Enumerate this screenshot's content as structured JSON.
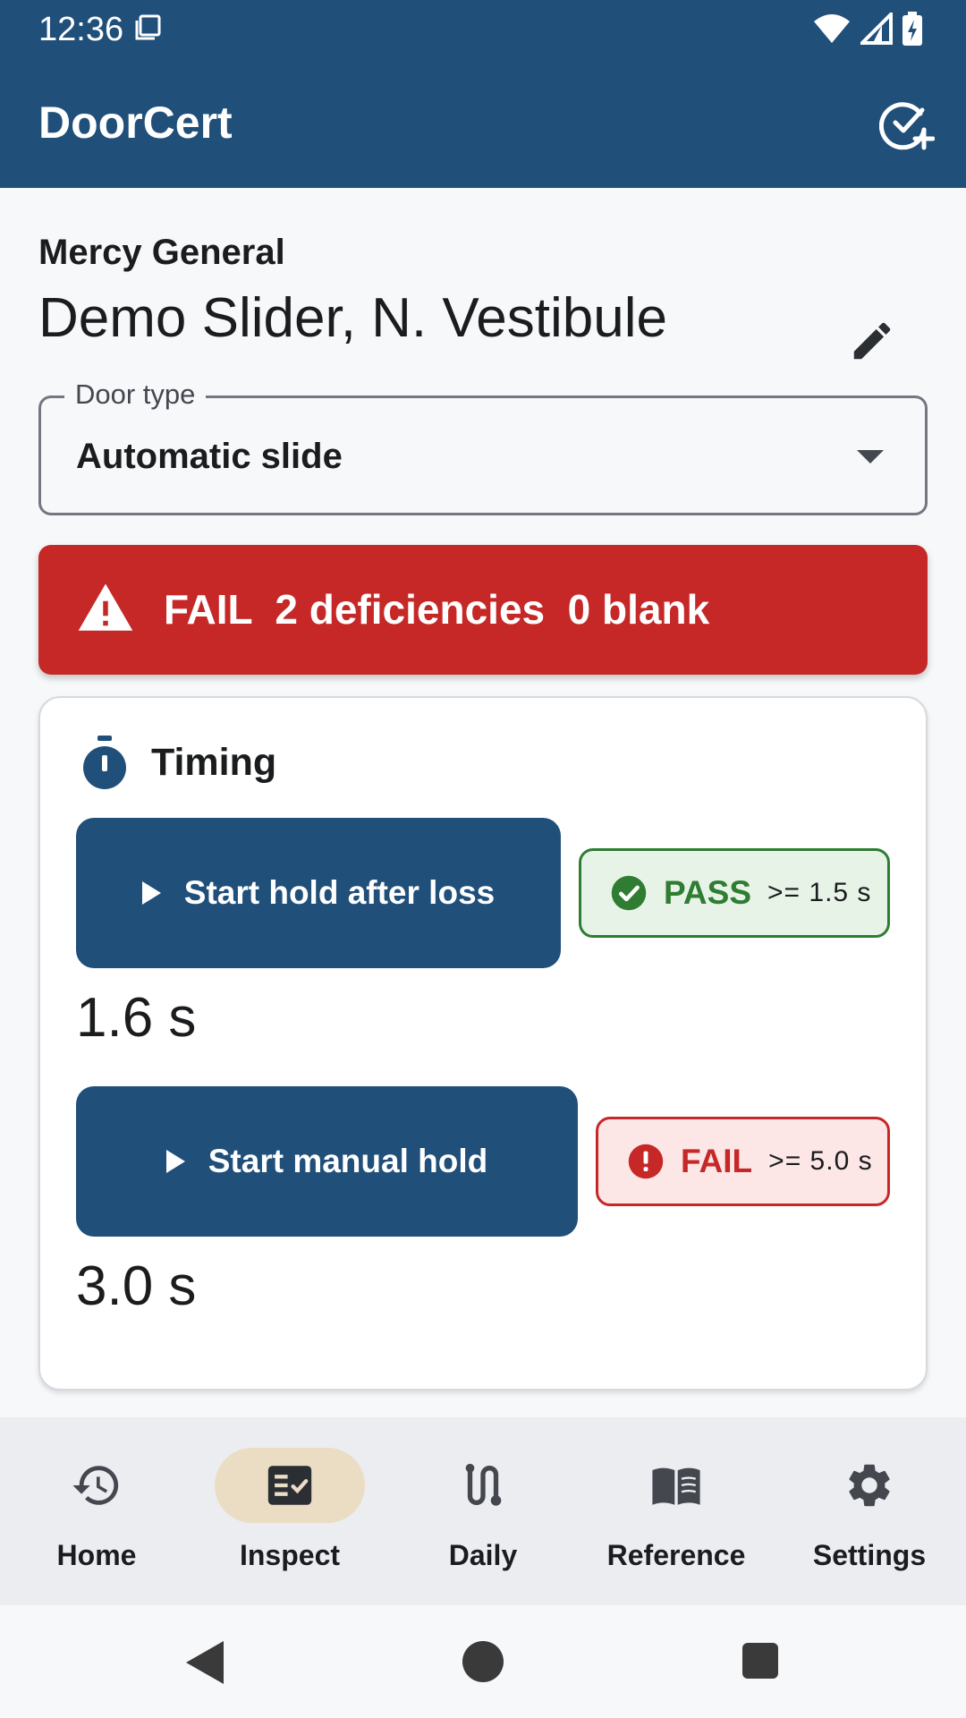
{
  "status_bar": {
    "time": "12:36"
  },
  "app_bar": {
    "title": "DoorCert"
  },
  "header": {
    "facility": "Mercy General",
    "door_name": "Demo Slider, N. Vestibule"
  },
  "door_type": {
    "label": "Door type",
    "value": "Automatic slide"
  },
  "banner": {
    "text": "FAIL  2 deficiencies  0 blank",
    "color": "#C62828"
  },
  "timing": {
    "title": "Timing",
    "tests": [
      {
        "button_label": "Start hold after loss",
        "status": "PASS",
        "threshold": ">= 1.5 s",
        "measured": "1.6 s"
      },
      {
        "button_label": "Start manual hold",
        "status": "FAIL",
        "threshold": ">= 5.0 s",
        "measured": "3.0 s"
      }
    ]
  },
  "bottom_nav": {
    "items": [
      {
        "label": "Home",
        "icon": "history-icon",
        "active": false
      },
      {
        "label": "Inspect",
        "icon": "checklist-icon",
        "active": true
      },
      {
        "label": "Daily",
        "icon": "route-icon",
        "active": false
      },
      {
        "label": "Reference",
        "icon": "book-icon",
        "active": false
      },
      {
        "label": "Settings",
        "icon": "gear-icon",
        "active": false
      }
    ]
  },
  "colors": {
    "primary": "#204F7A",
    "fail": "#C62828",
    "pass": "#2E7D32",
    "nav_active": "#EBDDC3"
  }
}
